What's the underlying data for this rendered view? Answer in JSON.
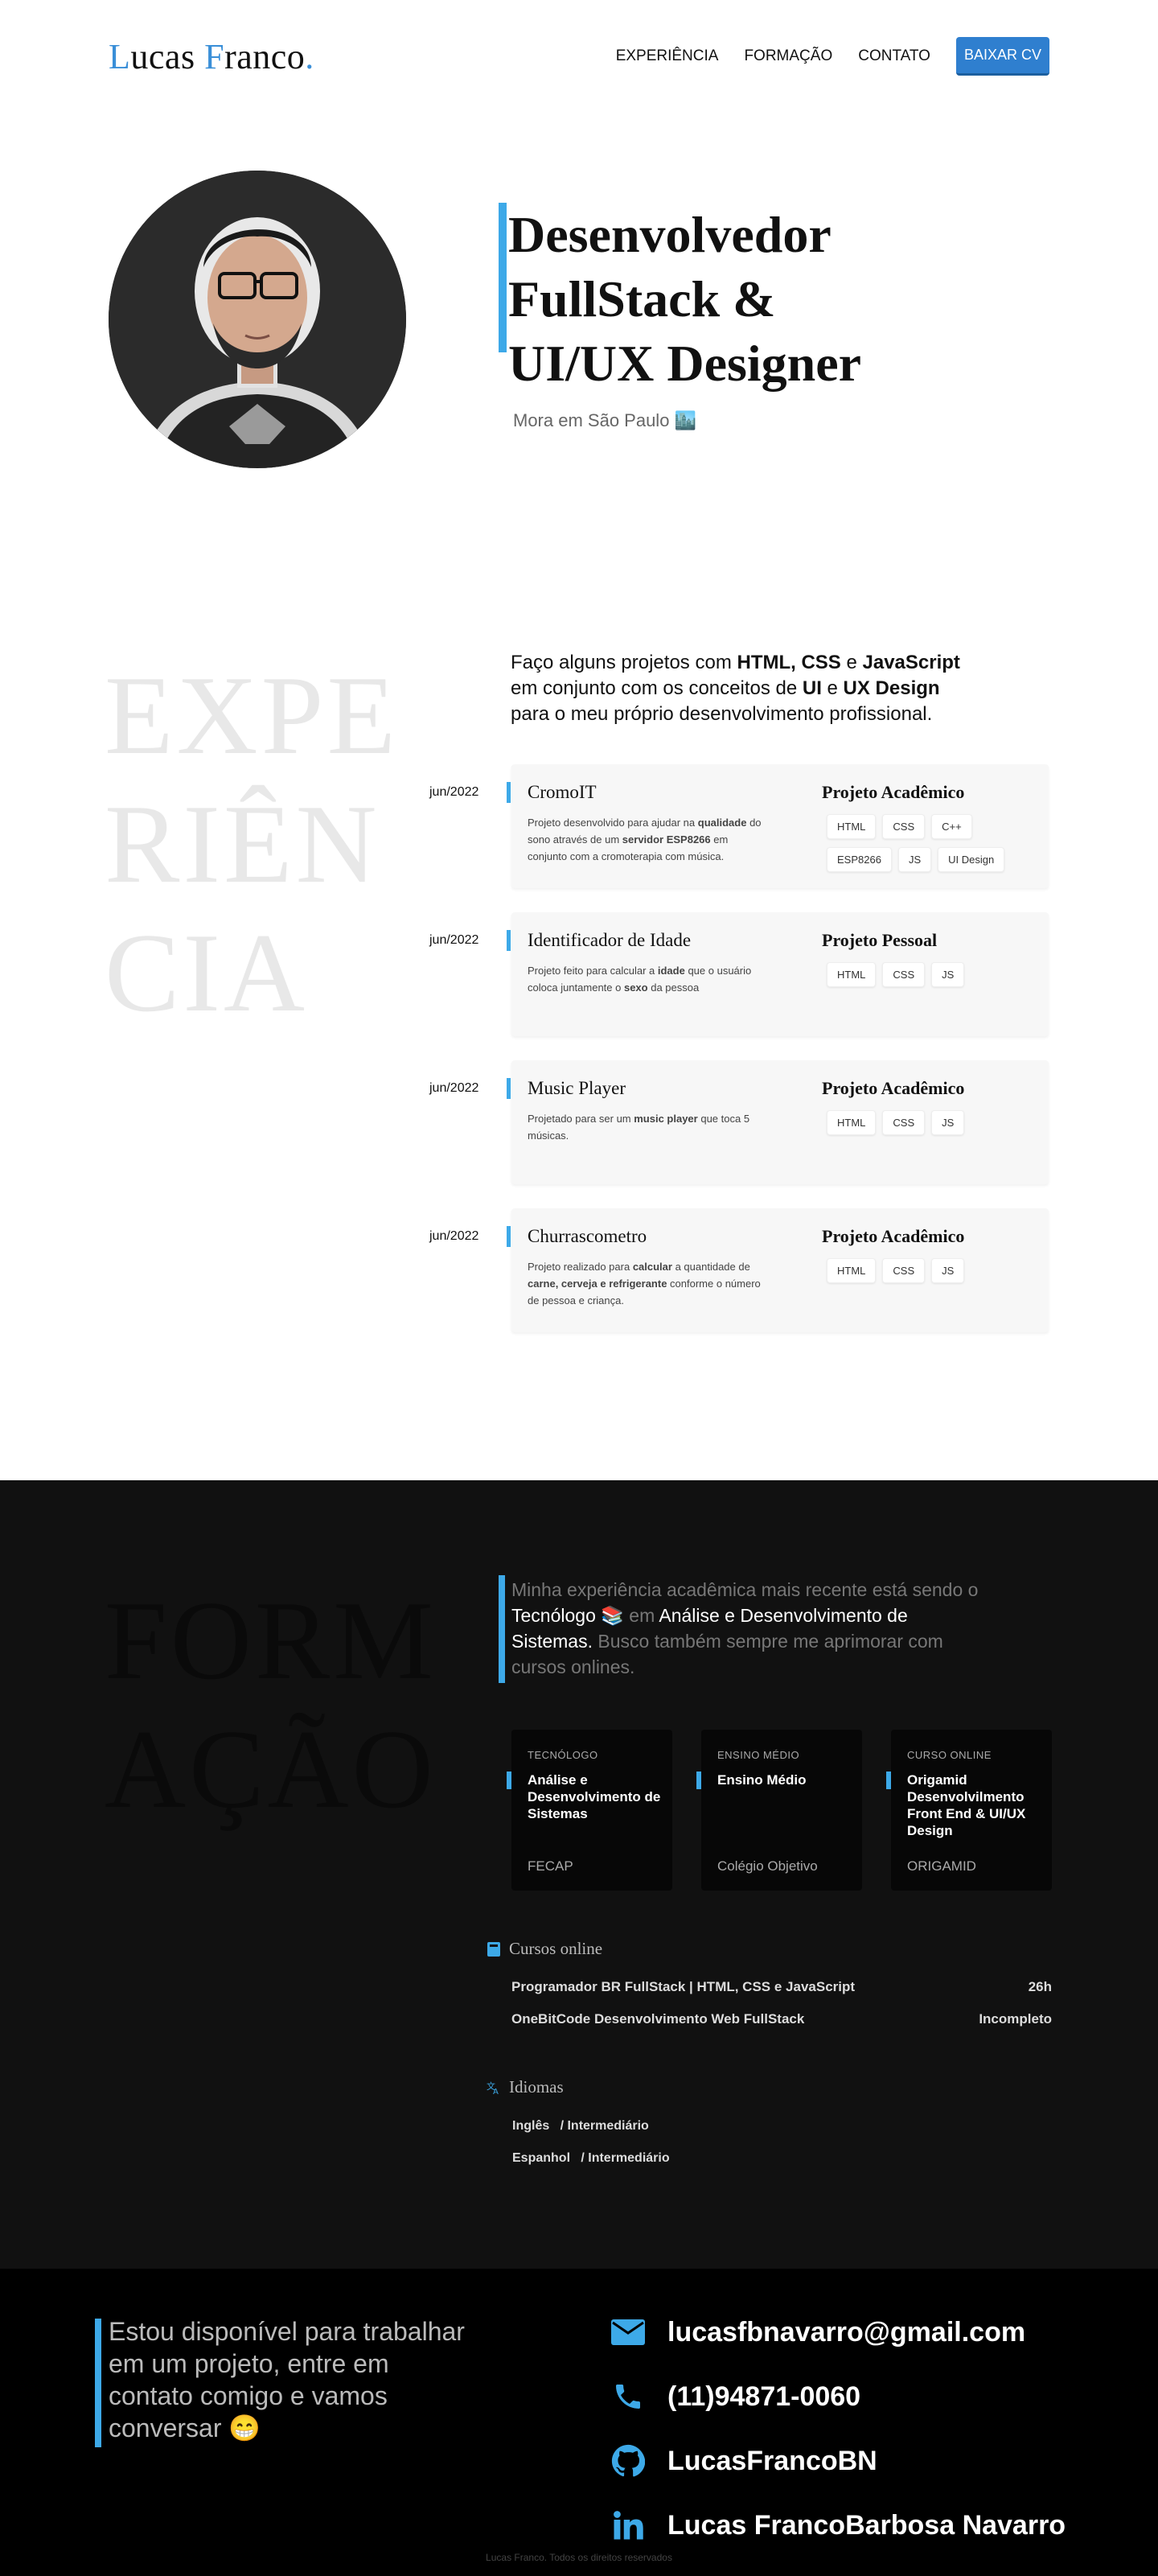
{
  "header": {
    "logo_first": "Lucas",
    "logo_second": "Franco",
    "nav": [
      "EXPERIÊNCIA",
      "FORMAÇÃO",
      "CONTATO"
    ],
    "cv_button": "BAIXAR CV"
  },
  "hero": {
    "title_lines": [
      "Desenvolvedor",
      "FullStack &",
      "UI/UX Designer"
    ],
    "subtitle": "Mora em São Paulo 🏙️"
  },
  "experience": {
    "big_word": [
      "EXPE",
      "RIÊN",
      "CIA"
    ],
    "intro_parts": [
      "Faço alguns projetos com ",
      "HTML, CSS",
      " e ",
      "JavaScript",
      " em conjunto com os conceitos de ",
      "UI",
      " e ",
      "UX Design",
      " para o meu próprio desenvolvimento profissional."
    ],
    "projects": [
      {
        "date": "jun/2022",
        "title": "CromoIT",
        "desc_parts": [
          "Projeto desenvolvido para ajudar na ",
          "qualidade",
          " do sono através de um ",
          "servidor ESP8266",
          " em conjunto com a cromoterapia com música."
        ],
        "kind": "Projeto Acadêmico",
        "tags": [
          "HTML",
          "CSS",
          "C++",
          "ESP8266",
          "JS",
          "UI Design"
        ]
      },
      {
        "date": "jun/2022",
        "title": "Identificador de Idade",
        "desc_parts": [
          "Projeto feito para calcular a ",
          "idade",
          " que o usuário coloca juntamente o ",
          "sexo",
          " da pessoa"
        ],
        "kind": "Projeto Pessoal",
        "tags": [
          "HTML",
          "CSS",
          "JS"
        ]
      },
      {
        "date": "jun/2022",
        "title": "Music Player",
        "desc_parts": [
          "Projetado para ser um ",
          "music player",
          " que toca 5 músicas."
        ],
        "kind": "Projeto Acadêmico",
        "tags": [
          "HTML",
          "CSS",
          "JS"
        ]
      },
      {
        "date": "jun/2022",
        "title": "Churrascometro",
        "desc_parts": [
          "Projeto realizado para ",
          "calcular",
          " a quantidade de ",
          "carne, cerveja e refrigerante",
          " conforme o número de pessoa e criança."
        ],
        "kind": "Projeto Acadêmico",
        "tags": [
          "HTML",
          "CSS",
          "JS"
        ]
      }
    ]
  },
  "formation": {
    "big_word": [
      "FORM",
      "AÇÃO"
    ],
    "intro_parts": [
      "Minha experiência acadêmica mais recente está sendo o ",
      "Tecnólogo 📚",
      " em ",
      "Análise e Desenvolvimento de Sistemas.",
      " Busco também sempre me aprimorar com cursos onlines."
    ],
    "cards": [
      {
        "kind": "TECNÓLOGO",
        "title": "Análise e Desenvolvimento de Sistemas",
        "school": "FECAP"
      },
      {
        "kind": "ENSINO MÉDIO",
        "title": "Ensino Médio",
        "school": "Colégio Objetivo"
      },
      {
        "kind": "CURSO ONLINE",
        "title": "Origamid Desenvolvilmento Front End & UI/UX Design",
        "school": "ORIGAMID"
      }
    ],
    "courses_heading": "Cursos online",
    "courses": [
      {
        "name": "Programador BR FullStack | HTML, CSS e JavaScript",
        "duration": "26h"
      },
      {
        "name": "OneBitCode Desenvolvimento Web FullStack",
        "duration": "Incompleto"
      }
    ],
    "languages_heading": "Idiomas",
    "languages": [
      {
        "name": "Inglês",
        "level": "/ Intermediário"
      },
      {
        "name": "Espanhol",
        "level": "/ Intermediário"
      }
    ]
  },
  "contact": {
    "text": "Estou disponível para trabalhar em um projeto, entre em contato comigo e vamos conversar 😁",
    "email": "lucasfbnavarro@gmail.com",
    "phone": "(11)94871-0060",
    "github": "LucasFrancoBN",
    "linkedin": "Lucas FrancoBarbosa Navarro",
    "icons": [
      "mail-icon",
      "phone-icon",
      "github-icon",
      "linkedin-icon"
    ],
    "accent": "#3da9e8"
  },
  "footer": {
    "text": "Lucas Franco. Todos os direitos reservados"
  }
}
